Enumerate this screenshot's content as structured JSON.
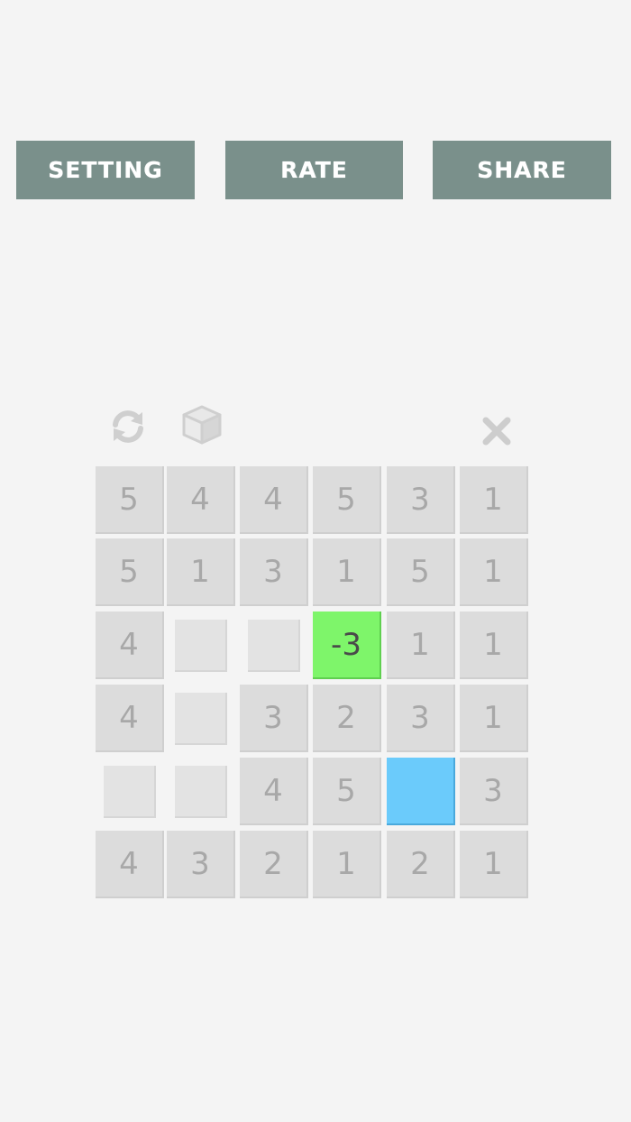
{
  "toolbar": {
    "setting_label": "SETTING",
    "rate_label": "RATE",
    "share_label": "SHARE",
    "button_color": "#7a908b"
  },
  "game_controls": {
    "restart_icon": "refresh-icon",
    "cube_icon": "cube-icon",
    "close_icon": "close-icon"
  },
  "board": {
    "rows": [
      [
        "5",
        "4",
        "4",
        "5",
        "3",
        "1"
      ],
      [
        "5",
        "1",
        "3",
        "1",
        "5",
        "1"
      ],
      [
        "4",
        "",
        "",
        "-3",
        "1",
        "1"
      ],
      [
        "4",
        "",
        "3",
        "2",
        "3",
        "1"
      ],
      [
        "",
        "",
        "4",
        "5",
        "",
        "3"
      ],
      [
        "4",
        "3",
        "2",
        "1",
        "2",
        "1"
      ]
    ],
    "selected_cell_color": "#7ef56a",
    "cursor_cell_color": "#6bcbfb",
    "tile_color": "#dcdcdc"
  }
}
